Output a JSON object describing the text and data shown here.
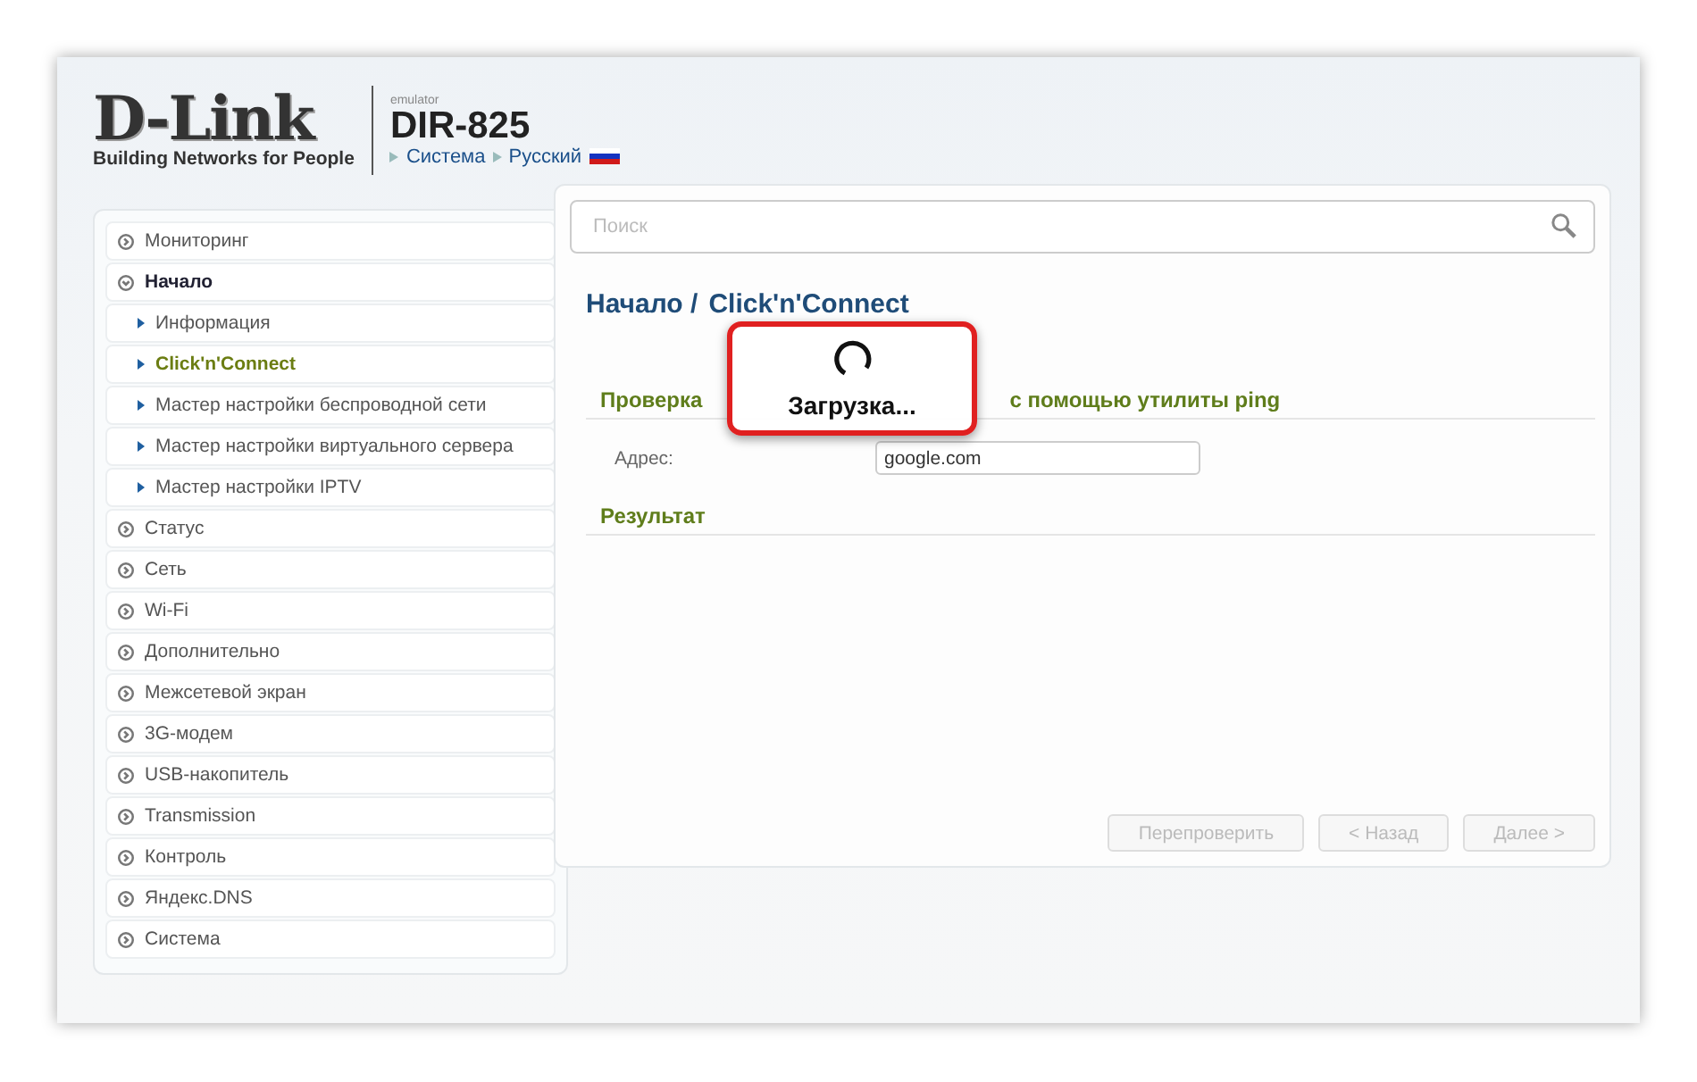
{
  "header": {
    "logo": "D-Link",
    "tagline": "Building Networks for People",
    "emulator": "emulator",
    "model": "DIR-825",
    "breadcrumb": [
      "Система",
      "Русский"
    ]
  },
  "sidebar": {
    "items": [
      {
        "kind": "section",
        "label": "Мониторинг",
        "expanded": false
      },
      {
        "kind": "section",
        "label": "Начало",
        "expanded": true
      },
      {
        "kind": "sub",
        "label": "Информация",
        "selected": false
      },
      {
        "kind": "sub",
        "label": "Click'n'Connect",
        "selected": true
      },
      {
        "kind": "sub",
        "label": "Мастер настройки беспроводной сети",
        "selected": false
      },
      {
        "kind": "sub",
        "label": "Мастер настройки виртуального сервера",
        "selected": false
      },
      {
        "kind": "sub",
        "label": "Мастер настройки IPTV",
        "selected": false
      },
      {
        "kind": "section",
        "label": "Статус",
        "expanded": false
      },
      {
        "kind": "section",
        "label": "Сеть",
        "expanded": false
      },
      {
        "kind": "section",
        "label": "Wi-Fi",
        "expanded": false
      },
      {
        "kind": "section",
        "label": "Дополнительно",
        "expanded": false
      },
      {
        "kind": "section",
        "label": "Межсетевой экран",
        "expanded": false
      },
      {
        "kind": "section",
        "label": "3G-модем",
        "expanded": false
      },
      {
        "kind": "section",
        "label": "USB-накопитель",
        "expanded": false
      },
      {
        "kind": "section",
        "label": "Transmission",
        "expanded": false
      },
      {
        "kind": "section",
        "label": "Контроль",
        "expanded": false
      },
      {
        "kind": "section",
        "label": "Яндекс.DNS",
        "expanded": false
      },
      {
        "kind": "section",
        "label": "Система",
        "expanded": false
      }
    ]
  },
  "search": {
    "placeholder": "Поиск"
  },
  "page_title": [
    "Начало /",
    "Click'n'Connect"
  ],
  "ping_section": {
    "title_parts": [
      "Проверка",
      "с помощью утилиты ping"
    ],
    "address_label": "Адрес:",
    "address_value": "google.com"
  },
  "result_section": {
    "title": "Результат"
  },
  "buttons": [
    {
      "label": "Перепроверить",
      "disabled": true
    },
    {
      "label": "< Назад",
      "disabled": true
    },
    {
      "label": "Далее >",
      "disabled": true
    }
  ],
  "loading_dialog": {
    "text": "Загрузка..."
  }
}
